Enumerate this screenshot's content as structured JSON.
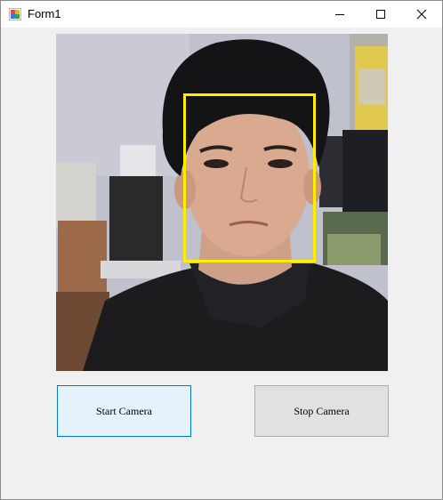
{
  "window": {
    "title": "Form1",
    "icon": "winforms-app-icon",
    "controls": {
      "minimize_icon": "minimize-icon",
      "maximize_icon": "maximize-icon",
      "close_icon": "close-icon"
    }
  },
  "camera": {
    "feed": "webcam-feed",
    "detection_color": "#ffee00"
  },
  "buttons": {
    "start_label": "Start Camera",
    "stop_label": "Stop Camera"
  },
  "colors": {
    "form_background": "#f0f0f0",
    "start_button_bg": "#e5f1fb",
    "start_button_border": "#0078d7",
    "stop_button_bg": "#e1e1e1"
  }
}
